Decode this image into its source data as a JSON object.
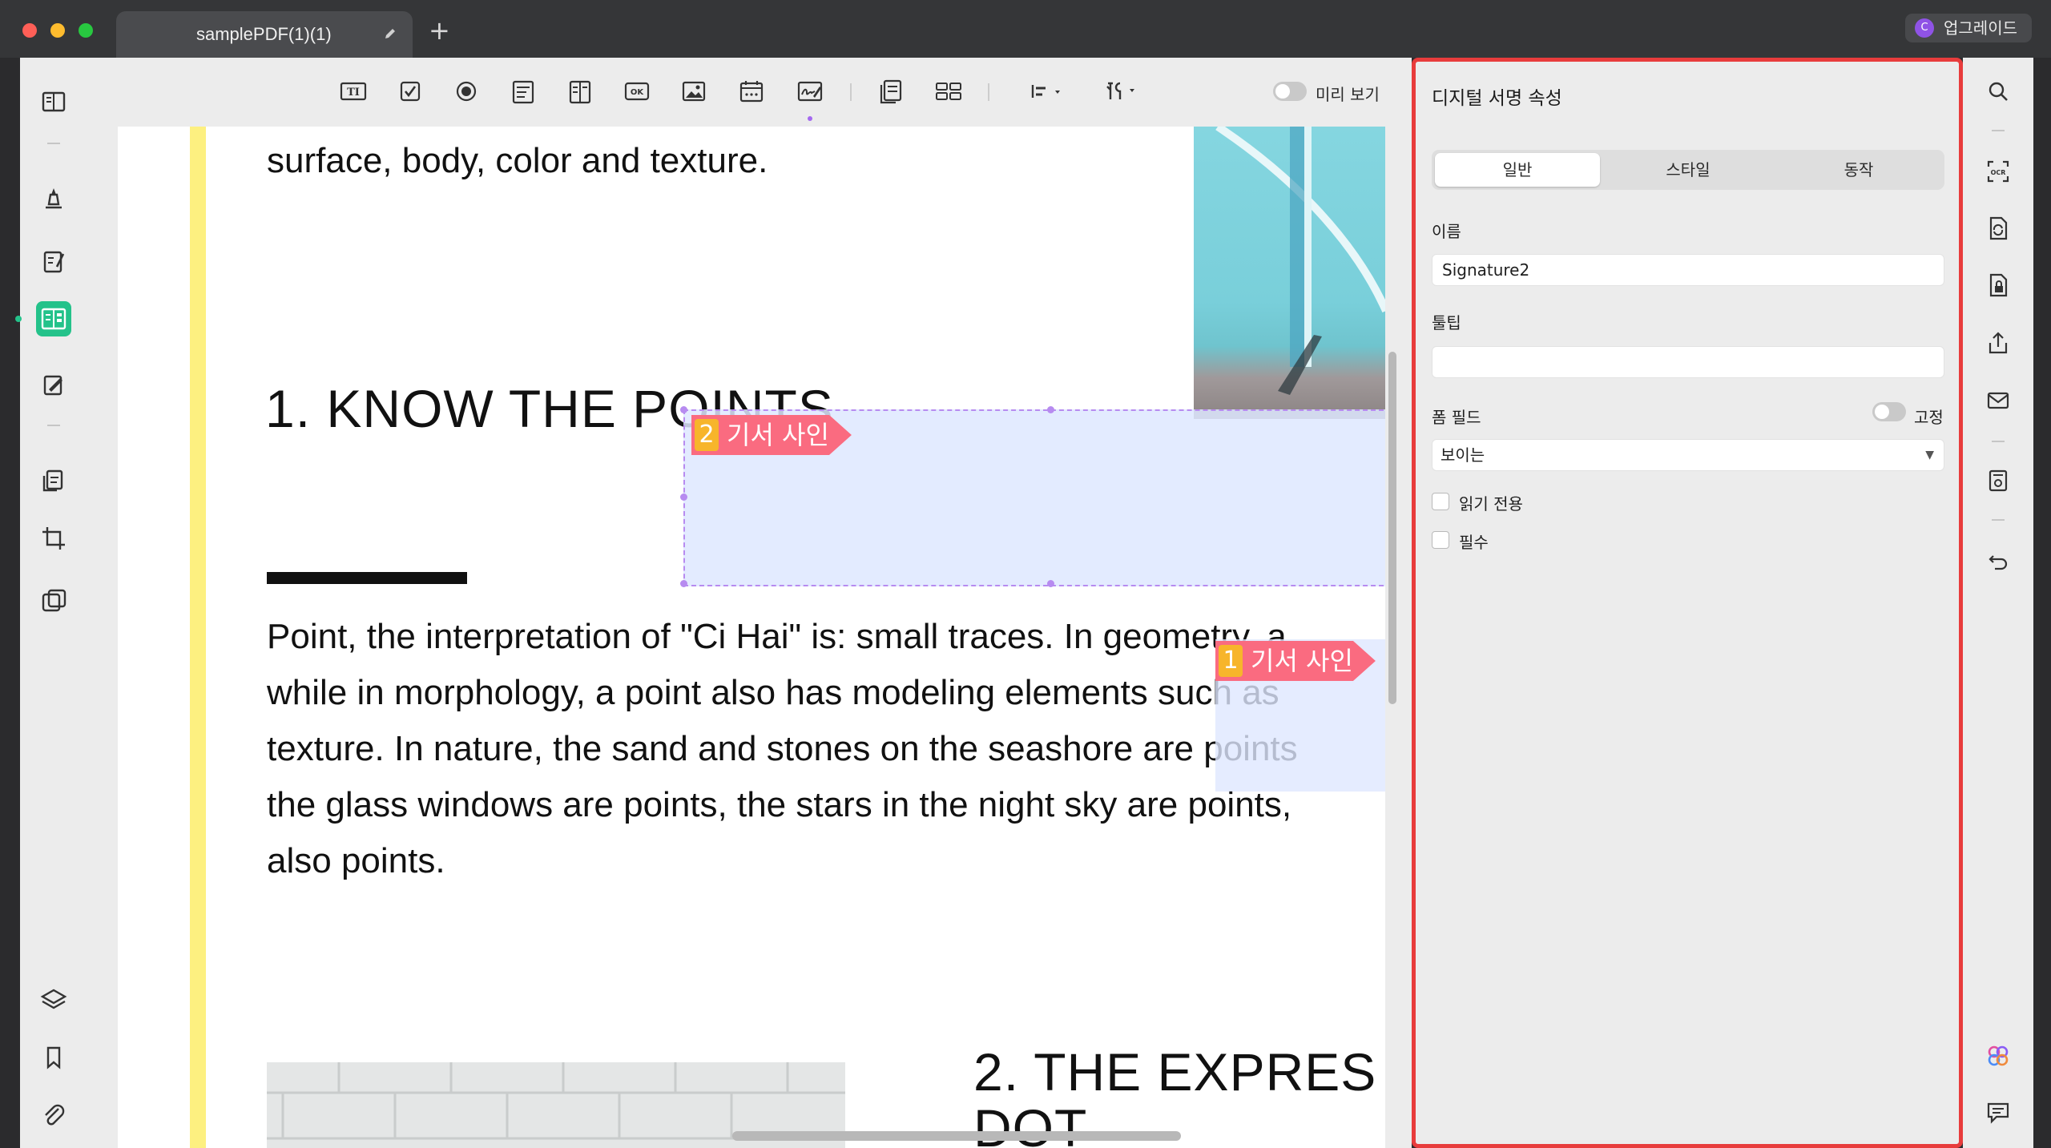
{
  "tab": {
    "title": "samplePDF(1)(1)"
  },
  "account": {
    "avatar_letter": "C",
    "upgrade_label": "업그레이드"
  },
  "toolbar": {
    "preview_label": "미리 보기"
  },
  "document": {
    "line_top": "surface, body, color and texture.",
    "heading1": "1. KNOW THE POINTS",
    "para": [
      "Point, the interpretation of \"Ci Hai\" is: small traces. In geometry, a",
      "while in morphology, a point also has modeling elements such as",
      "texture. In nature, the sand and stones on the seashore are points",
      "the glass windows are points, the stars in the night sky are points,",
      "also points."
    ],
    "heading2_line1": "2. THE   EXPRES",
    "heading2_line2": "DOT"
  },
  "signature_fields": [
    {
      "number": "2",
      "label": "기서 사인"
    },
    {
      "number": "1",
      "label": "기서 사인"
    }
  ],
  "properties": {
    "title": "디지털 서명 속성",
    "tabs": [
      "일반",
      "스타일",
      "동작"
    ],
    "active_tab": "일반",
    "name_label": "이름",
    "name_value": "Signature2",
    "tooltip_label": "툴팁",
    "tooltip_value": "",
    "form_field_label": "폼 필드",
    "fixed_label": "고정",
    "visibility_value": "보이는",
    "readonly_label": "읽기 전용",
    "required_label": "필수"
  },
  "colors": {
    "panel_border": "#e83c3c",
    "active_tool": "#24c28a",
    "signature_tag": "#fa6b80",
    "signature_number": "#f7b52b",
    "field_outline": "#b78bf0",
    "highlight_bar": "#fdf080"
  }
}
